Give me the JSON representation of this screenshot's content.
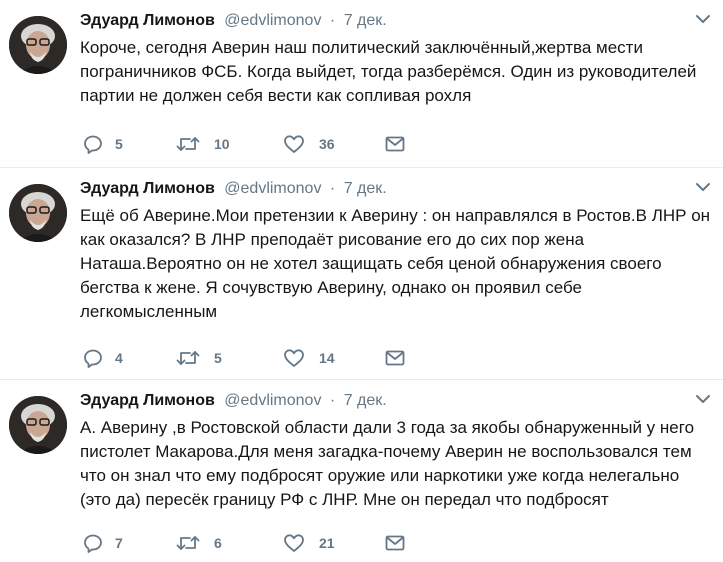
{
  "tweets": [
    {
      "name": "Эдуард Лимонов",
      "handle": "@edvlimonov",
      "separator": "·",
      "time": "7 дек.",
      "text": "Короче, сегодня Аверин наш политический заключённый,жертва мести пограничников ФСБ. Когда выйдет, тогда разберёмся. Один из руководителей партии не должен себя вести как сопливая рохля",
      "replies": "5",
      "retweets": "10",
      "likes": "36"
    },
    {
      "name": "Эдуард Лимонов",
      "handle": "@edvlimonov",
      "separator": "·",
      "time": "7 дек.",
      "text": "Ещё об Аверине.Мои  претензии к Аверину : он направлялся в Ростов.В ЛНР он как оказался? В ЛНР преподаёт рисование его до сих пор жена Наташа.Вероятно он не хотел защищать себя ценой обнаружения своего бегства к жене. Я сочувствую Аверину, однако он проявил себе легкомысленным",
      "replies": "4",
      "retweets": "5",
      "likes": "14"
    },
    {
      "name": "Эдуард Лимонов",
      "handle": "@edvlimonov",
      "separator": "·",
      "time": "7 дек.",
      "text": "А. Аверину ,в Ростовской области дали 3 года за якобы обнаруженный у него пистолет Макарова.Для меня загадка-почему Аверин не воспользовался тем что он знал что ему подбросят оружие или наркотики уже когда нелегально (это да) пересёк границу РФ с ЛНР. Мне он передал что подбросят",
      "replies": "7",
      "retweets": "6",
      "likes": "21"
    }
  ],
  "icons": {
    "reply": "reply-icon",
    "retweet": "retweet-icon",
    "like": "heart-icon",
    "dm": "envelope-icon",
    "more": "chevron-down-icon"
  },
  "colors": {
    "icon": "#657786",
    "divider": "#e6ecf0",
    "text": "#14171a"
  }
}
